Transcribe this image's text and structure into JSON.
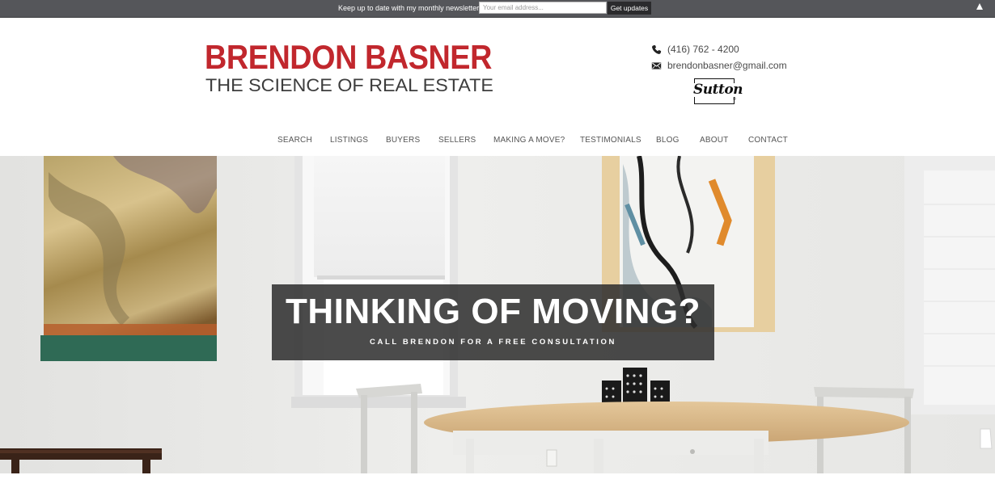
{
  "newsletter": {
    "text": "Keep up to date with my monthly newsletter",
    "email_placeholder": "Your email address...",
    "button_label": "Get updates"
  },
  "logo": {
    "name": "BRENDON BASNER",
    "tagline": "THE SCIENCE OF REAL ESTATE",
    "accent_color": "#c1272d"
  },
  "contact": {
    "phone": "(416) 762 - 4200",
    "email": "brendonbasner@gmail.com",
    "brokerage_logo_text": "Sutton",
    "brokerage_logo_reg": "®"
  },
  "nav": {
    "items": [
      {
        "label": "SEARCH"
      },
      {
        "label": "LISTINGS"
      },
      {
        "label": "BUYERS"
      },
      {
        "label": "SELLERS"
      },
      {
        "label": "MAKING A MOVE?"
      },
      {
        "label": "TESTIMONIALS"
      },
      {
        "label": "BLOG"
      },
      {
        "label": "ABOUT"
      },
      {
        "label": "CONTACT"
      }
    ]
  },
  "hero": {
    "title": "THINKING OF MOVING?",
    "subtitle": "CALL BRENDON FOR A FREE CONSULTATION"
  }
}
